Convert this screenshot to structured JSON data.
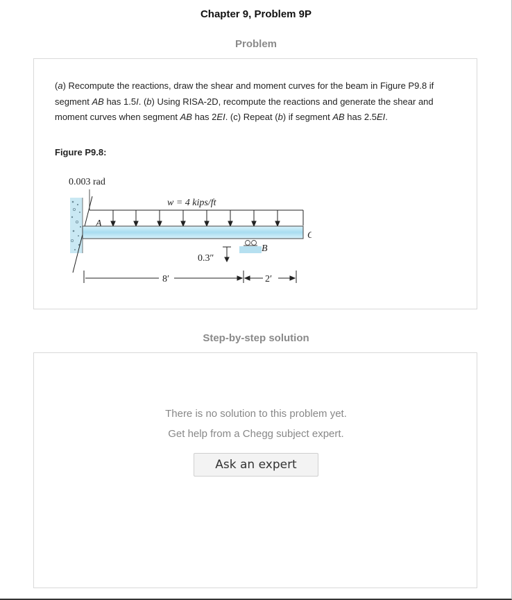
{
  "header": {
    "title": "Chapter 9, Problem 9P"
  },
  "problem": {
    "section_label": "Problem",
    "text_parts": [
      {
        "t": "(",
        "i": false
      },
      {
        "t": "a",
        "i": true
      },
      {
        "t": ") Recompute the reactions, draw the shear and moment curves for the beam in Figure P9.8 if segment ",
        "i": false
      },
      {
        "t": "AB",
        "i": true
      },
      {
        "t": " has 1.5",
        "i": false
      },
      {
        "t": "I",
        "i": true
      },
      {
        "t": ". (",
        "i": false
      },
      {
        "t": "b",
        "i": true
      },
      {
        "t": ") Using RISA-2D, recompute the reactions and generate the shear and moment curves when segment ",
        "i": false
      },
      {
        "t": "AB",
        "i": true
      },
      {
        "t": " has 2",
        "i": false
      },
      {
        "t": "EI",
        "i": true
      },
      {
        "t": ". (c) Repeat (",
        "i": false
      },
      {
        "t": "b",
        "i": true
      },
      {
        "t": ") if segment ",
        "i": false
      },
      {
        "t": "AB",
        "i": true
      },
      {
        "t": " has 2.5",
        "i": false
      },
      {
        "t": "EI",
        "i": true
      },
      {
        "t": ".",
        "i": false
      }
    ],
    "figure_label": "Figure P9.8:",
    "figure": {
      "rotation_label": "0.003 rad",
      "load_label": "w = 4 kips/ft",
      "point_a": "A",
      "point_b": "B",
      "point_c": "C",
      "settlement_label": "0.3″",
      "span_ab": "8′",
      "span_bc": "2′"
    }
  },
  "solution": {
    "section_label": "Step-by-step solution",
    "empty_line1": "There is no solution to this problem yet.",
    "empty_line2": "Get help from a Chegg subject expert.",
    "ask_button": "Ask an expert"
  }
}
